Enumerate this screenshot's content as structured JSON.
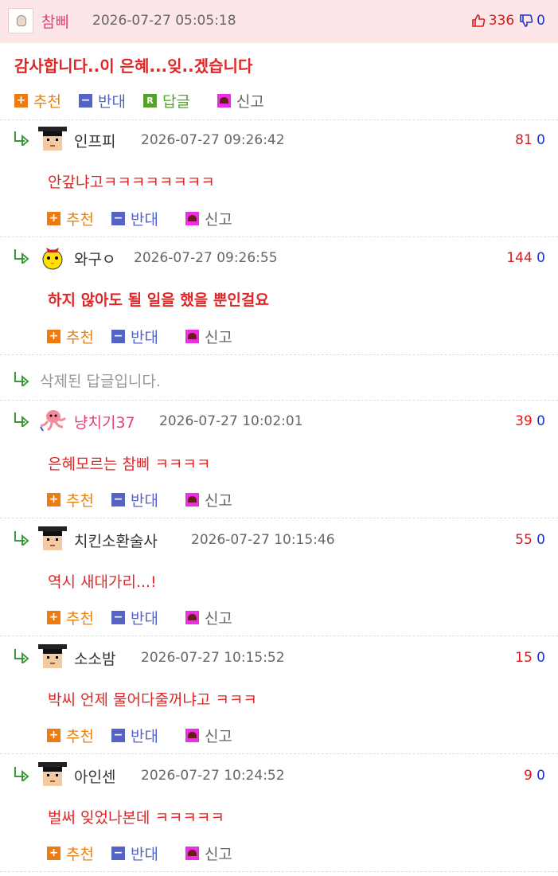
{
  "post": {
    "author": "참삐",
    "date": "2026-07-27 05:05:18",
    "up": "336",
    "down": "0",
    "title": "감사합니다..이 은혜...잊..겠습니다"
  },
  "labels": {
    "up": "추천",
    "down": "반대",
    "reply": "답글",
    "report": "신고"
  },
  "deleted_text": "삭제된 답글입니다.",
  "comments": [
    {
      "author": "인프피",
      "date": "2026-07-27 09:26:42",
      "up": "81",
      "down": "0",
      "text": "안갚냐고ㅋㅋㅋㅋㅋㅋㅋㅋ"
    },
    {
      "author": "와구ㅇ",
      "date": "2026-07-27 09:26:55",
      "up": "144",
      "down": "0",
      "text": "하지 않아도 될 일을 했을 뿐인걸요"
    },
    {
      "author": "냥치기37",
      "date": "2026-07-27 10:02:01",
      "up": "39",
      "down": "0",
      "text": "은혜모르는 참삐 ㅋㅋㅋㅋ"
    },
    {
      "author": "치킨소환술사",
      "date": "2026-07-27 10:15:46",
      "up": "55",
      "down": "0",
      "text": "역시 새대가리...!"
    },
    {
      "author": "소소밤",
      "date": "2026-07-27 10:15:52",
      "up": "15",
      "down": "0",
      "text": "박씨 언제 물어다줄꺼냐고 ㅋㅋㅋ"
    },
    {
      "author": "아인센",
      "date": "2026-07-27 10:24:52",
      "up": "9",
      "down": "0",
      "text": "벌써 잊었나본데 ㅋㅋㅋㅋㅋ"
    }
  ],
  "colors": {
    "header_bg": "#fde6e8",
    "text_red": "#e02626",
    "up_count": "#e01818",
    "down_count": "#1a34c8",
    "name_pink": "#e0407a"
  }
}
